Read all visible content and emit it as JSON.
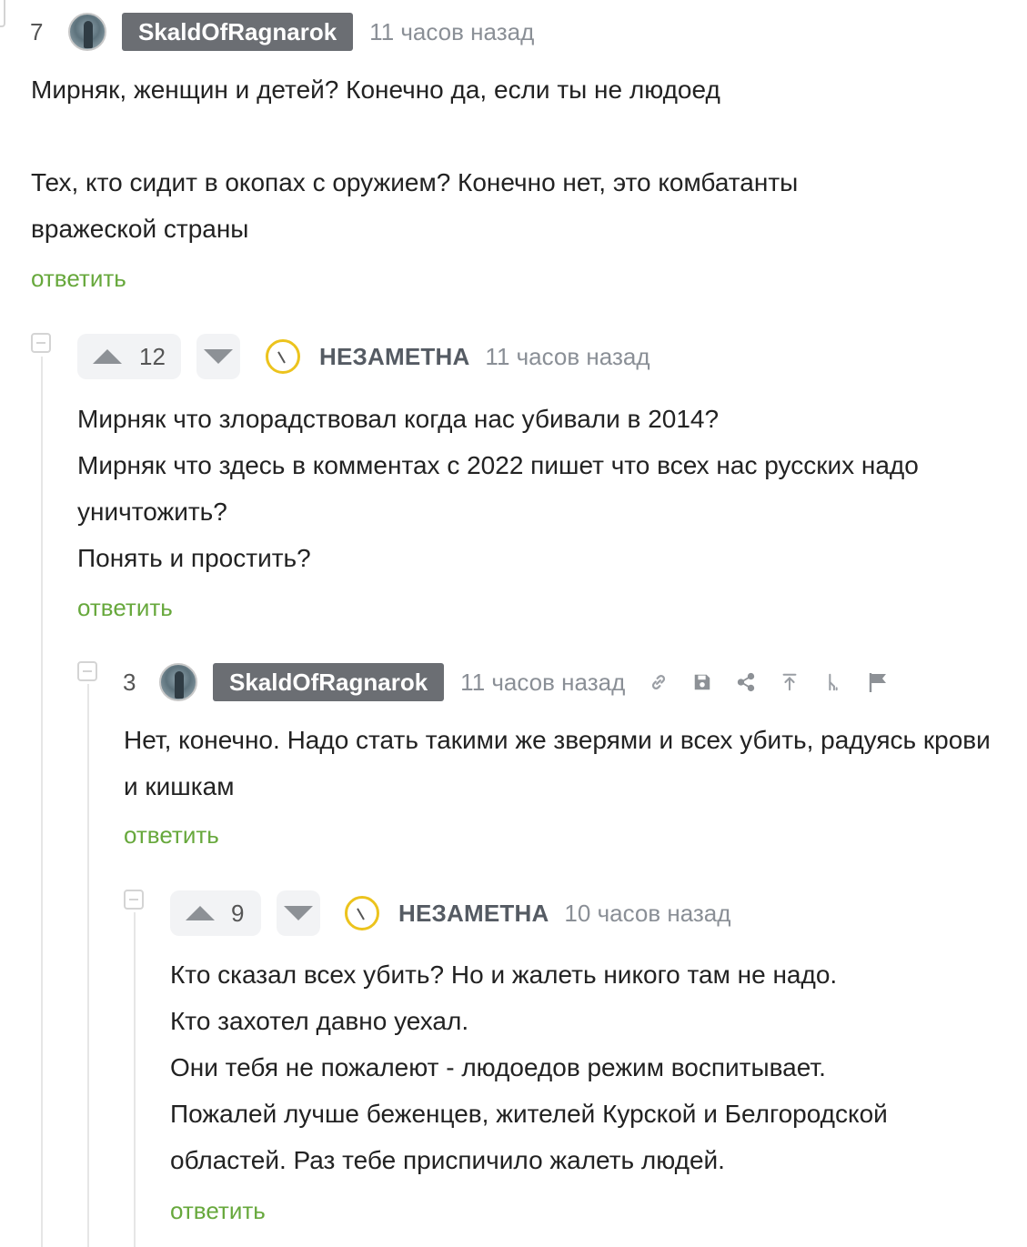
{
  "comments": [
    {
      "rating": "7",
      "author": "SkaldOfRagnarok",
      "time": "11 часов назад",
      "paragraphs": [
        "Мирняк, женщин и детей? Конечно да, если ты не людоед",
        "",
        "Тех, кто сидит в окопах с оружием? Конечно нет, это комбатанты вражеской страны"
      ],
      "reply_label": "ответить"
    },
    {
      "rating": "12",
      "author": "НЕЗАМЕТНА",
      "time": "11 часов назад",
      "paragraphs": [
        "Мирняк что злорадствовал когда нас убивали в 2014?",
        "Мирняк что здесь в комментах с 2022 пишет что всех нас русских надо уничтожить?",
        "Понять и простить?"
      ],
      "reply_label": "ответить"
    },
    {
      "rating": "3",
      "author": "SkaldOfRagnarok",
      "time": "11 часов назад",
      "paragraphs": [
        "Нет, конечно. Надо стать такими же зверями и всех убить, радуясь крови и кишкам"
      ],
      "reply_label": "ответить",
      "actions": [
        "link-icon",
        "save-icon",
        "share-icon",
        "go-to-parent-icon",
        "branch-icon",
        "report-flag-icon"
      ]
    },
    {
      "rating": "9",
      "author": "НЕЗАМЕТНА",
      "time": "10 часов назад",
      "paragraphs": [
        "Кто сказал всех убить? Но и жалеть никого там не надо.",
        "Кто захотел давно уехал.",
        "Они тебя не пожалеют - людоедов режим воспитывает.",
        "Пожалей лучше беженцев, жителей Курской и Белгородской областей. Раз тебе приспичило жалеть людей."
      ],
      "reply_label": "ответить"
    }
  ],
  "colors": {
    "reply_link": "#67a83c",
    "user_badge": "#6b6e73",
    "clock_avatar_ring": "#ecc31d"
  }
}
